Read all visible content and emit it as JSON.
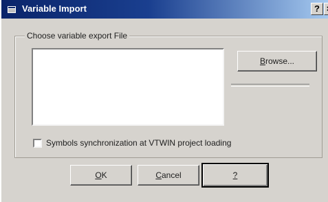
{
  "window": {
    "title": "Variable Import",
    "help_glyph": "?",
    "close_glyph": "×"
  },
  "group": {
    "label": "Choose variable export File"
  },
  "buttons": {
    "browse_mnemonic": "B",
    "browse_rest": "rowse...",
    "ok_mnemonic": "O",
    "ok_rest": "K",
    "cancel_mnemonic": "C",
    "cancel_rest": "ancel",
    "help_label": "?"
  },
  "checkbox": {
    "label": "Symbols synchronization at VTWIN project loading",
    "checked": false
  },
  "icons": {
    "app": "window-app-icon",
    "help": "help-icon",
    "close": "close-icon"
  }
}
